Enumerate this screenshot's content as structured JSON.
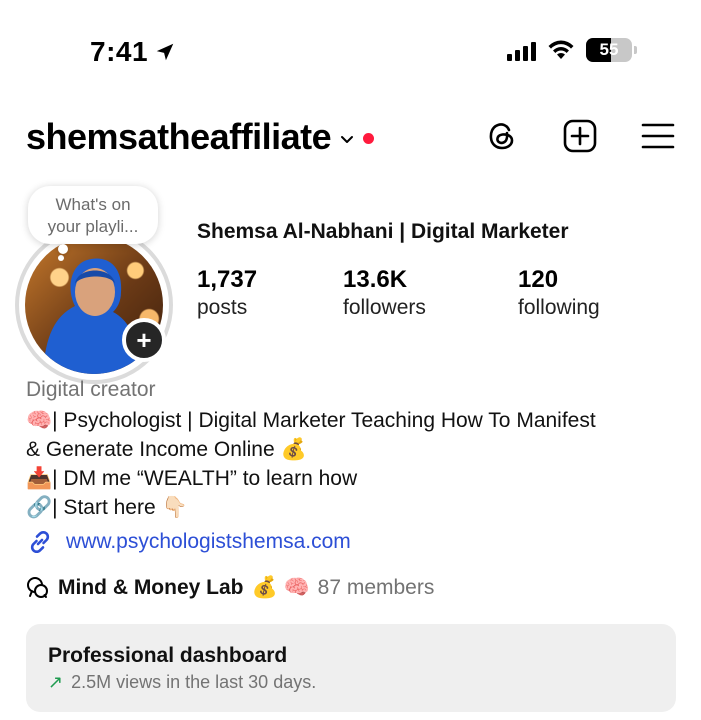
{
  "status_bar": {
    "time": "7:41",
    "battery": "55",
    "icons": [
      "location-arrow-icon",
      "signal-icon",
      "wifi-icon",
      "battery-icon"
    ]
  },
  "header": {
    "username": "shemsatheaffiliate",
    "icons": [
      "chevron-down-icon",
      "notification-dot",
      "threads-icon",
      "create-plus-icon",
      "menu-icon"
    ],
    "accent_red": "#ff1a3d"
  },
  "profile": {
    "note_bubble": "What's on your playli...",
    "full_name": "Shemsa Al-Nabhani | Digital Marketer",
    "stats": [
      {
        "value": "1,737",
        "label": "posts"
      },
      {
        "value": "13.6K",
        "label": "followers"
      },
      {
        "value": "120",
        "label": "following"
      }
    ]
  },
  "bio": {
    "category": "Digital creator",
    "lines": [
      "🧠| Psychologist | Digital Marketer Teaching How To Manifest",
      "& Generate Income Online 💰",
      "📥| DM me “WEALTH” to learn how",
      "🔗| Start here 👇🏻"
    ],
    "link": "www.psychologistshemsa.com",
    "link_color": "#2d4fd6"
  },
  "community": {
    "name": "Mind & Money Lab",
    "emojis": "💰 🧠",
    "members": "87 members"
  },
  "dashboard": {
    "title": "Professional dashboard",
    "subtitle": "2.5M views in the last 30 days.",
    "trend_color": "#1f9b50"
  }
}
